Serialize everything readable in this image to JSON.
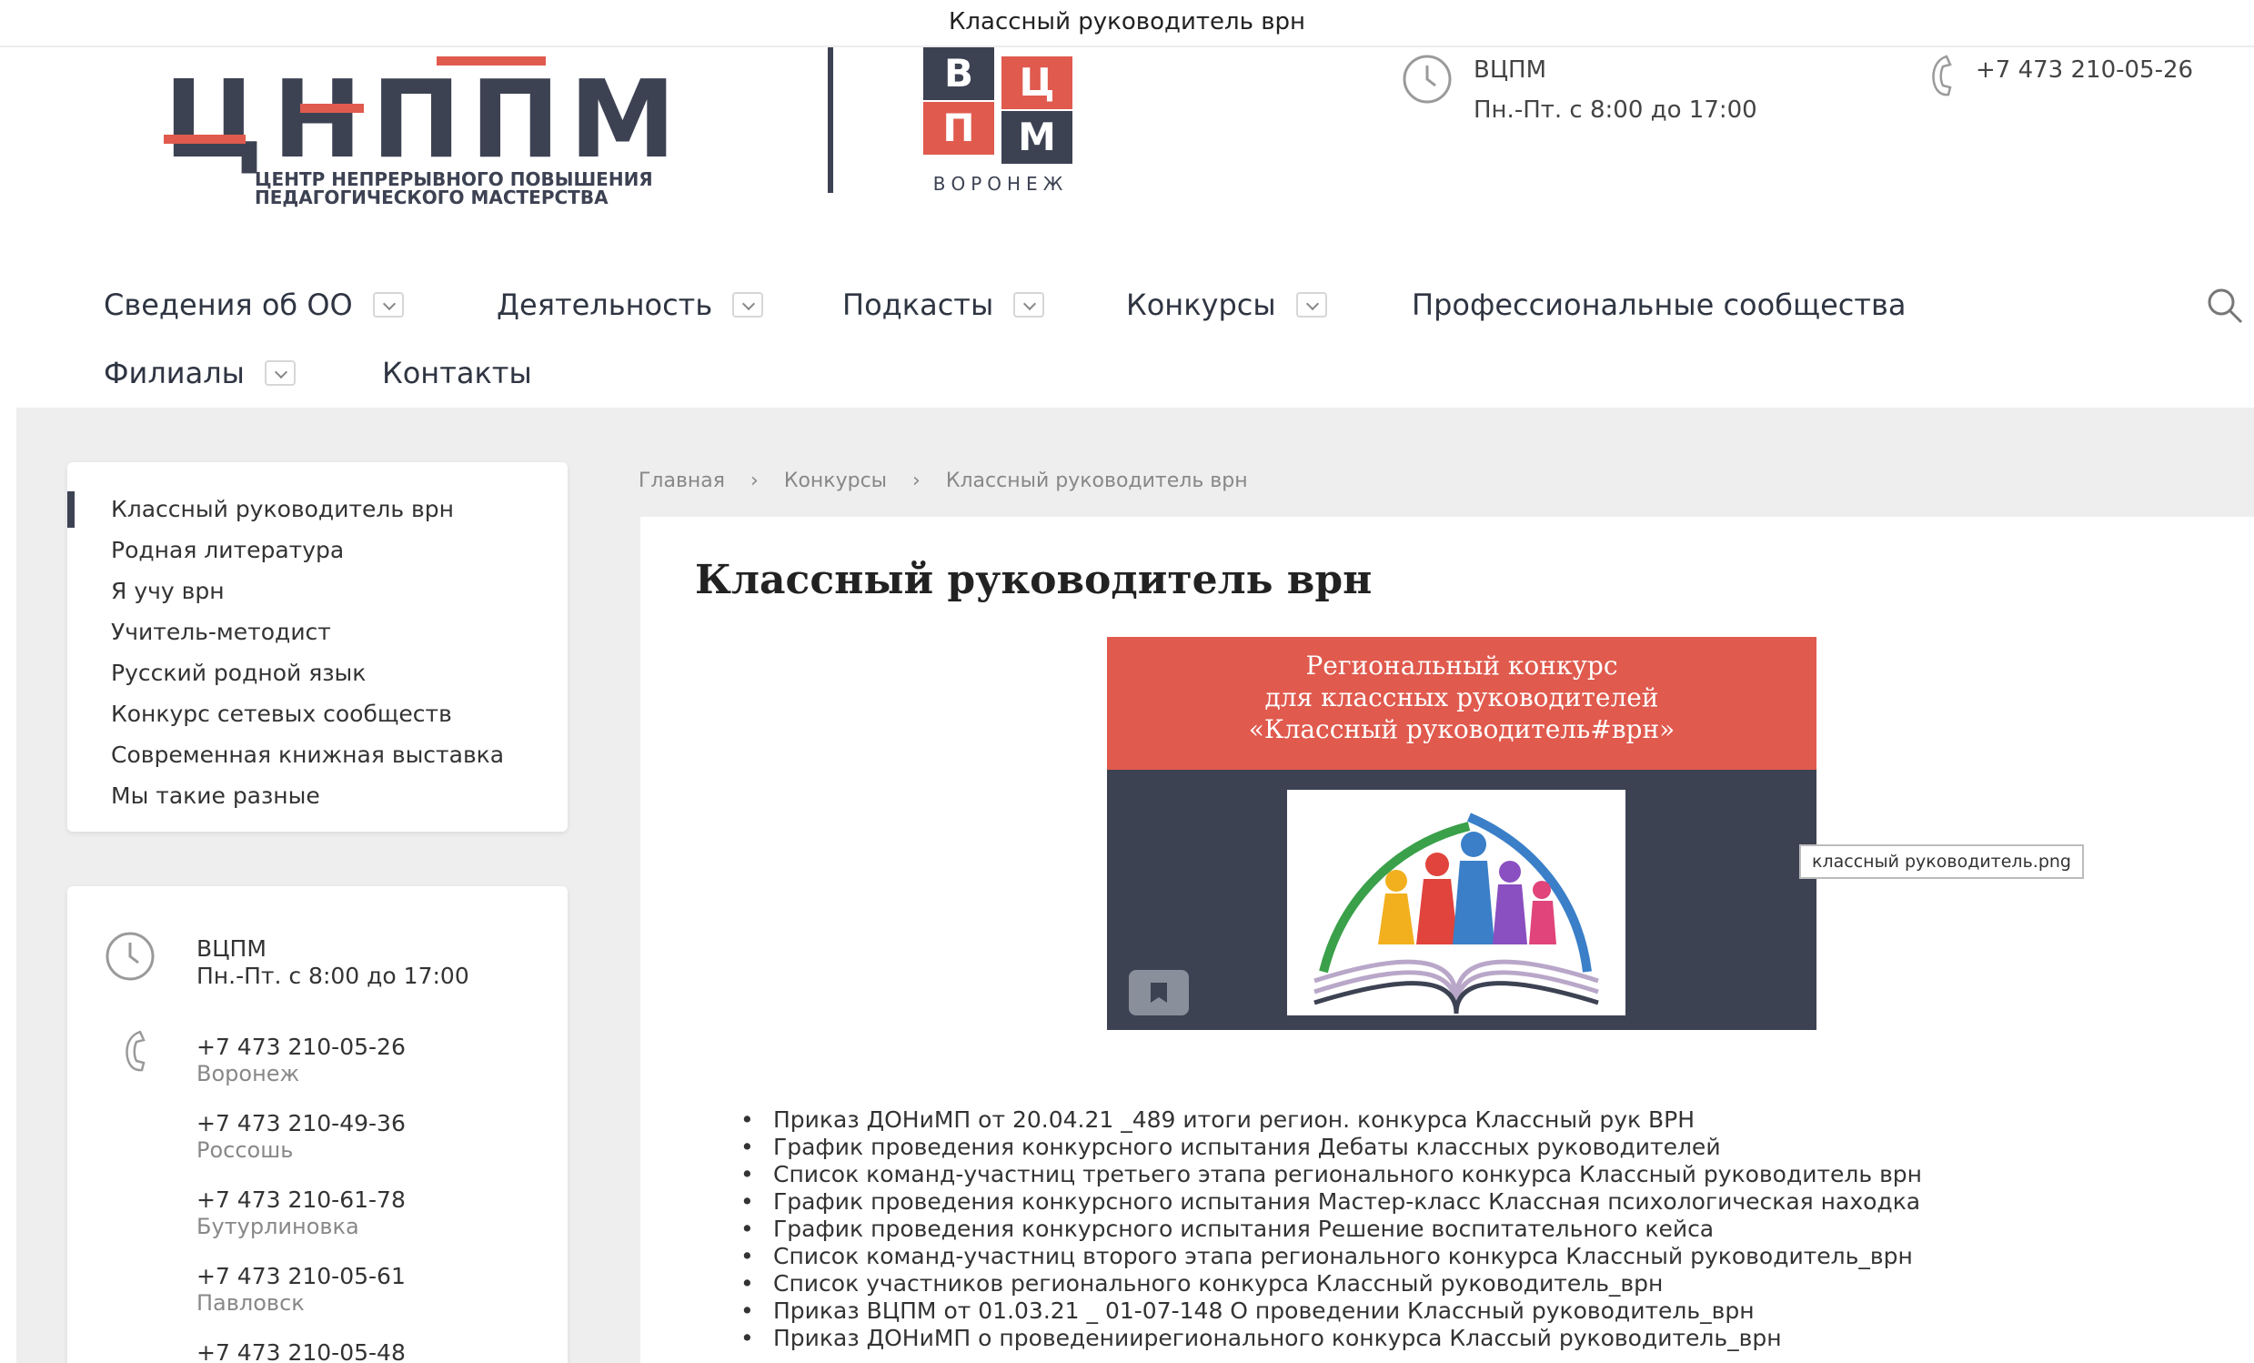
{
  "window": {
    "title": "Классный руководитель врн"
  },
  "header": {
    "logo_letters": [
      "Ц",
      "Н",
      "П",
      "П",
      "М"
    ],
    "logo_text_line1": "ЦЕНТР НЕПРЕРЫВНОГО ПОВЫШЕНИЯ",
    "logo_text_line2": "ПЕДАГОГИЧЕСКОГО МАСТЕРСТВА",
    "vcpm_letters": [
      "В",
      "Ц",
      "П",
      "М"
    ],
    "vcpm_city": "ВОРОНЕЖ",
    "org": "ВЦПМ",
    "hours": "Пн.-Пт. с 8:00 до 17:00",
    "phone": "+7 473 210-05-26"
  },
  "nav": {
    "items": [
      {
        "label": "Сведения об ОО",
        "dropdown": true
      },
      {
        "label": "Деятельность",
        "dropdown": true
      },
      {
        "label": "Подкасты",
        "dropdown": true
      },
      {
        "label": "Конкурсы",
        "dropdown": true
      },
      {
        "label": "Профессиональные сообщества",
        "dropdown": false
      },
      {
        "label": "Филиалы",
        "dropdown": true
      },
      {
        "label": "Контакты",
        "dropdown": false
      }
    ]
  },
  "sidebar": {
    "items": [
      "Классный руководитель врн",
      "Родная литература",
      "Я учу врн",
      "Учитель-методист",
      "Русский родной язык",
      "Конкурс сетевых сообществ",
      "Современная книжная выставка",
      "Мы такие разные"
    ],
    "active_index": 0
  },
  "contacts": {
    "org": "ВЦПМ",
    "hours": "Пн.-Пт. с 8:00 до 17:00",
    "phones": [
      {
        "phone": "+7 473 210-05-26",
        "city": "Воронеж"
      },
      {
        "phone": "+7 473 210-49-36",
        "city": "Россошь"
      },
      {
        "phone": "+7 473 210-61-78",
        "city": "Бутурлиновка"
      },
      {
        "phone": "+7 473 210-05-61",
        "city": "Павловск"
      },
      {
        "phone": "+7 473 210-05-48",
        "city": ""
      }
    ]
  },
  "breadcrumb": [
    "Главная",
    "Конкурсы",
    "Классный руководитель врн"
  ],
  "main": {
    "title": "Классный руководитель врн",
    "banner_lines": [
      "Региональный конкурс",
      "для классных руководителей",
      "«Классный руководитель#врн»"
    ],
    "image_tooltip": "классный руководитель.png",
    "documents": [
      "Приказ ДОНиМП от 20.04.21 _489 итоги регион. конкурса Классный рук ВРН",
      "График проведения конкурсного испытания Дебаты классных руководителей",
      "Список команд-участниц третьего этапа регионального конкурса Классный руководитель врн",
      "График проведения конкурсного испытания Мастер-класс Классная психологическая находка",
      "График проведения конкурсного испытания Решение воспитательного кейса",
      "Список команд-участниц второго этапа регионального конкурса Классный руководитель_врн",
      "Список участников регионального конкурса Классный руководитель_врн",
      "Приказ ВЦПМ от 01.03.21 _ 01-07-148 О проведении Классный руководитель_врн",
      "Приказ ДОНиМП о проведениирегионального конкурса Классый руководитель_врн"
    ]
  },
  "colors": {
    "brand_red": "#e05a4e",
    "brand_dark": "#3d4253"
  }
}
